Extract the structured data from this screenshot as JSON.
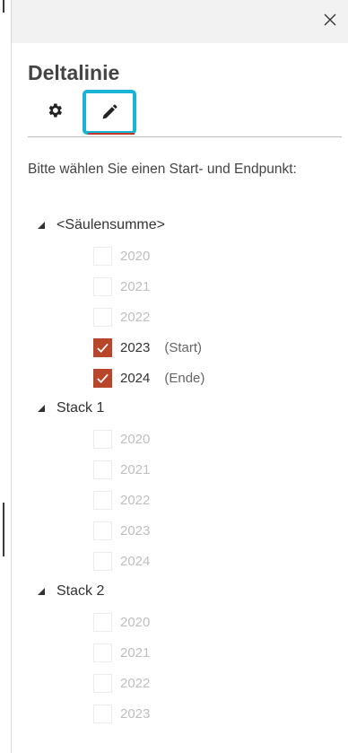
{
  "panel": {
    "title": "Deltalinie",
    "instruction": "Bitte wählen Sie einen Start- und Endpunkt:",
    "tabs": [
      {
        "icon": "gear-icon",
        "selected": false
      },
      {
        "icon": "pencil-icon",
        "selected": true
      }
    ],
    "accent_color": "#b7462a",
    "highlight_color": "#19b3d6"
  },
  "groups": [
    {
      "label": "<Säulensumme>",
      "items": [
        {
          "year": "2020",
          "checked": false,
          "tag": ""
        },
        {
          "year": "2021",
          "checked": false,
          "tag": ""
        },
        {
          "year": "2022",
          "checked": false,
          "tag": ""
        },
        {
          "year": "2023",
          "checked": true,
          "tag": "(Start)"
        },
        {
          "year": "2024",
          "checked": true,
          "tag": "(Ende)"
        }
      ]
    },
    {
      "label": "Stack 1",
      "items": [
        {
          "year": "2020",
          "checked": false,
          "tag": ""
        },
        {
          "year": "2021",
          "checked": false,
          "tag": ""
        },
        {
          "year": "2022",
          "checked": false,
          "tag": ""
        },
        {
          "year": "2023",
          "checked": false,
          "tag": ""
        },
        {
          "year": "2024",
          "checked": false,
          "tag": ""
        }
      ]
    },
    {
      "label": "Stack 2",
      "items": [
        {
          "year": "2020",
          "checked": false,
          "tag": ""
        },
        {
          "year": "2021",
          "checked": false,
          "tag": ""
        },
        {
          "year": "2022",
          "checked": false,
          "tag": ""
        },
        {
          "year": "2023",
          "checked": false,
          "tag": ""
        }
      ]
    }
  ]
}
